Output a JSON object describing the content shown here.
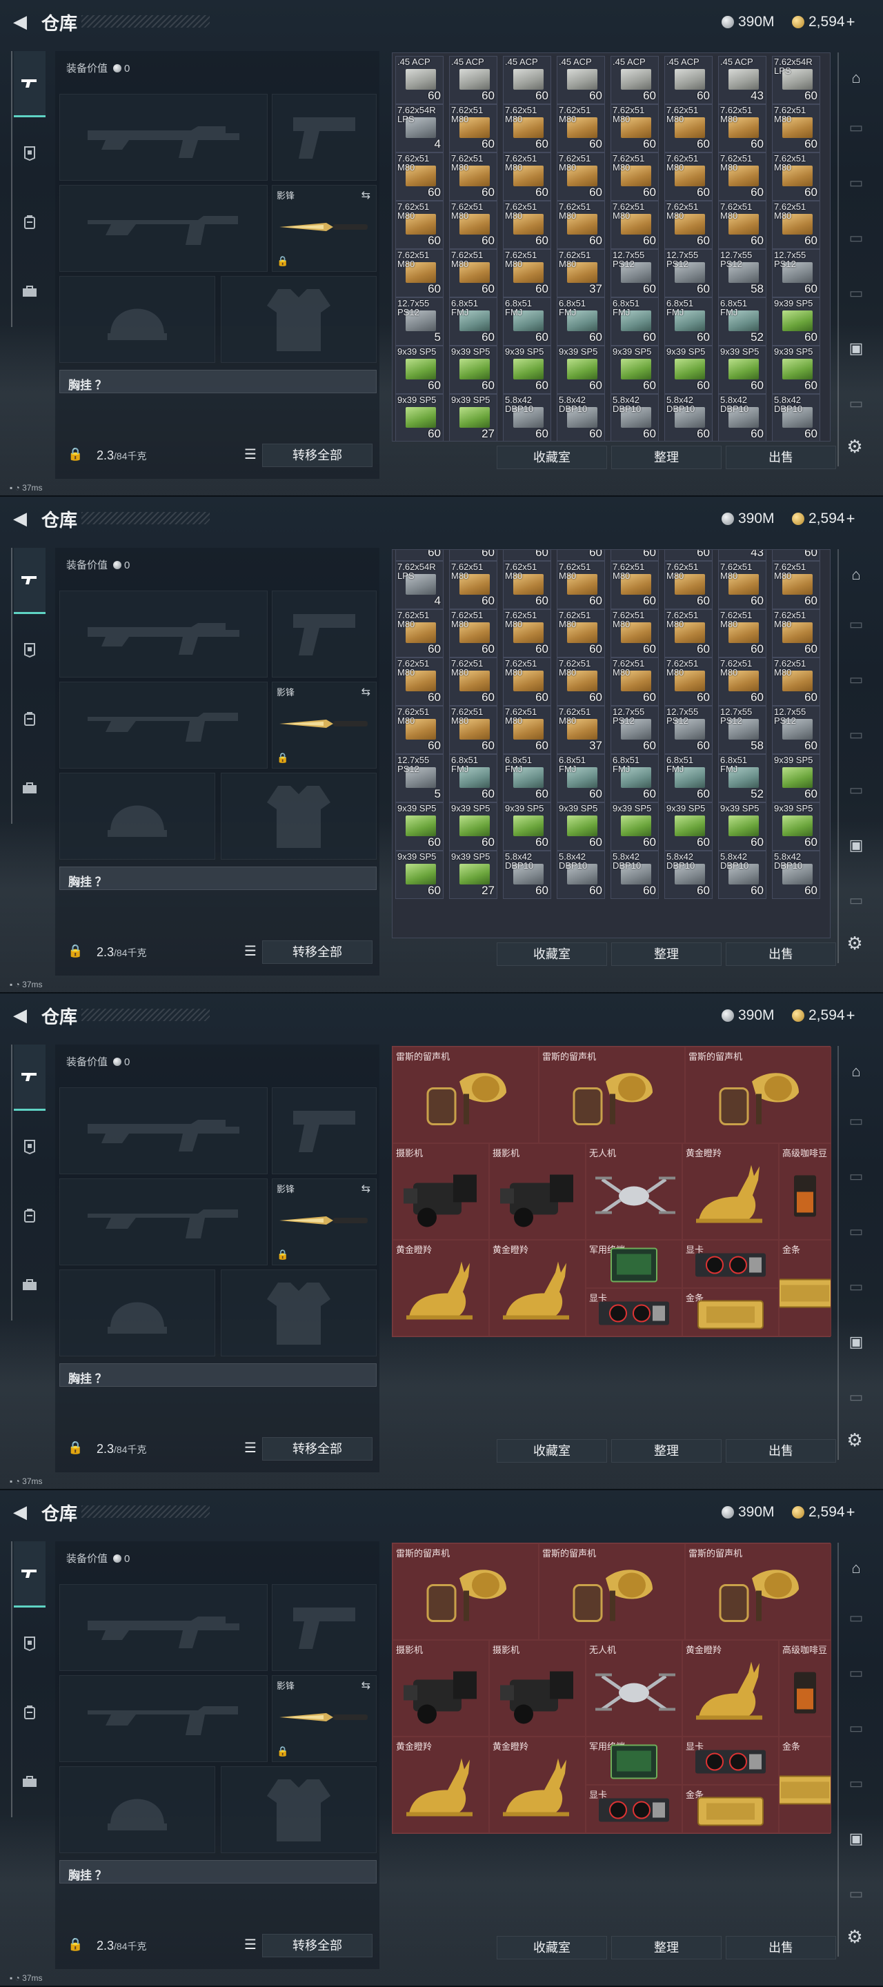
{
  "header": {
    "back_icon": "back-arrow-icon",
    "title": "仓库",
    "silver_amount": "390M",
    "gold_amount": "2,594",
    "plus": "+"
  },
  "left_nav": [
    "gun-icon",
    "armor-icon",
    "backpack-icon",
    "toolbox-icon"
  ],
  "equipment": {
    "value_label": "装备价值",
    "value": "0",
    "knife_label": "影锋",
    "rig_label": "胸挂",
    "rig_hint": "？",
    "weight": "2.3",
    "weight_cap": "/84千克",
    "transfer_all": "转移全部"
  },
  "actions": {
    "collection": "收藏室",
    "organize": "整理",
    "sell": "出售"
  },
  "status": {
    "signal": "37ms"
  },
  "ammo_grid": {
    "rows": [
      [
        [
          ".45 ACP",
          "60",
          "steel"
        ],
        [
          ".45 ACP",
          "60",
          "steel"
        ],
        [
          ".45 ACP",
          "60",
          "steel"
        ],
        [
          ".45 ACP",
          "60",
          "steel"
        ],
        [
          ".45 ACP",
          "60",
          "steel"
        ],
        [
          ".45 ACP",
          "60",
          "steel"
        ],
        [
          ".45 ACP",
          "43",
          "steel"
        ],
        [
          "7.62x54R LPS",
          "60",
          "steel"
        ]
      ],
      [
        [
          "7.62x54R LPS",
          "4",
          "gray"
        ],
        [
          "7.62x51 M80",
          "60",
          "brass"
        ],
        [
          "7.62x51 M80",
          "60",
          "brass"
        ],
        [
          "7.62x51 M80",
          "60",
          "brass"
        ],
        [
          "7.62x51 M80",
          "60",
          "brass"
        ],
        [
          "7.62x51 M80",
          "60",
          "brass"
        ],
        [
          "7.62x51 M80",
          "60",
          "brass"
        ],
        [
          "7.62x51 M80",
          "60",
          "brass"
        ]
      ],
      [
        [
          "7.62x51 M80",
          "60",
          "brass"
        ],
        [
          "7.62x51 M80",
          "60",
          "brass"
        ],
        [
          "7.62x51 M80",
          "60",
          "brass"
        ],
        [
          "7.62x51 M80",
          "60",
          "brass"
        ],
        [
          "7.62x51 M80",
          "60",
          "brass"
        ],
        [
          "7.62x51 M80",
          "60",
          "brass"
        ],
        [
          "7.62x51 M80",
          "60",
          "brass"
        ],
        [
          "7.62x51 M80",
          "60",
          "brass"
        ]
      ],
      [
        [
          "7.62x51 M80",
          "60",
          "brass"
        ],
        [
          "7.62x51 M80",
          "60",
          "brass"
        ],
        [
          "7.62x51 M80",
          "60",
          "brass"
        ],
        [
          "7.62x51 M80",
          "60",
          "brass"
        ],
        [
          "7.62x51 M80",
          "60",
          "brass"
        ],
        [
          "7.62x51 M80",
          "60",
          "brass"
        ],
        [
          "7.62x51 M80",
          "60",
          "brass"
        ],
        [
          "7.62x51 M80",
          "60",
          "brass"
        ]
      ],
      [
        [
          "7.62x51 M80",
          "60",
          "brass"
        ],
        [
          "7.62x51 M80",
          "60",
          "brass"
        ],
        [
          "7.62x51 M80",
          "60",
          "brass"
        ],
        [
          "7.62x51 M80",
          "37",
          "brass"
        ],
        [
          "12.7x55 PS12",
          "60",
          "gray"
        ],
        [
          "12.7x55 PS12",
          "60",
          "gray"
        ],
        [
          "12.7x55 PS12",
          "58",
          "gray"
        ],
        [
          "12.7x55 PS12",
          "60",
          "gray"
        ]
      ],
      [
        [
          "12.7x55 PS12",
          "5",
          "gray"
        ],
        [
          "6.8x51 FMJ",
          "60",
          "teal"
        ],
        [
          "6.8x51 FMJ",
          "60",
          "teal"
        ],
        [
          "6.8x51 FMJ",
          "60",
          "teal"
        ],
        [
          "6.8x51 FMJ",
          "60",
          "teal"
        ],
        [
          "6.8x51 FMJ",
          "60",
          "teal"
        ],
        [
          "6.8x51 FMJ",
          "52",
          "teal"
        ],
        [
          "9x39 SP5",
          "60",
          "green"
        ]
      ],
      [
        [
          "9x39 SP5",
          "60",
          "green"
        ],
        [
          "9x39 SP5",
          "60",
          "green"
        ],
        [
          "9x39 SP5",
          "60",
          "green"
        ],
        [
          "9x39 SP5",
          "60",
          "green"
        ],
        [
          "9x39 SP5",
          "60",
          "green"
        ],
        [
          "9x39 SP5",
          "60",
          "green"
        ],
        [
          "9x39 SP5",
          "60",
          "green"
        ],
        [
          "9x39 SP5",
          "60",
          "green"
        ]
      ],
      [
        [
          "9x39 SP5",
          "60",
          "green"
        ],
        [
          "9x39 SP5",
          "27",
          "green"
        ],
        [
          "5.8x42 DBP10",
          "60",
          "gray"
        ],
        [
          "5.8x42 DBP10",
          "60",
          "gray"
        ],
        [
          "5.8x42 DBP10",
          "60",
          "gray"
        ],
        [
          "5.8x42 DBP10",
          "60",
          "gray"
        ],
        [
          "5.8x42 DBP10",
          "60",
          "gray"
        ],
        [
          "5.8x42 DBP10",
          "60",
          "gray"
        ]
      ]
    ]
  },
  "valuables": [
    {
      "label": "雷斯的留声机",
      "icon": "gramophone-icon"
    },
    {
      "label": "雷斯的留声机",
      "icon": "gramophone-icon"
    },
    {
      "label": "雷斯的留声机",
      "icon": "gramophone-icon"
    },
    {
      "label": "摄影机",
      "icon": "camera-icon"
    },
    {
      "label": "摄影机",
      "icon": "camera-icon"
    },
    {
      "label": "无人机",
      "icon": "drone-icon"
    },
    {
      "label": "黄金瞪羚",
      "icon": "gazelle-icon"
    },
    {
      "label": "高级咖啡豆",
      "icon": "coffee-icon"
    },
    {
      "label": "黄金瞪羚",
      "icon": "gazelle-icon"
    },
    {
      "label": "黄金瞪羚",
      "icon": "gazelle-icon"
    },
    {
      "label": "军用终端",
      "icon": "terminal-icon"
    },
    {
      "label": "显卡",
      "icon": "gpu-icon"
    },
    {
      "label": "金条",
      "icon": "gold-bar-icon"
    },
    {
      "label": "显卡",
      "icon": "gpu-icon"
    },
    {
      "label": "金条",
      "icon": "gold-bar-icon"
    }
  ]
}
